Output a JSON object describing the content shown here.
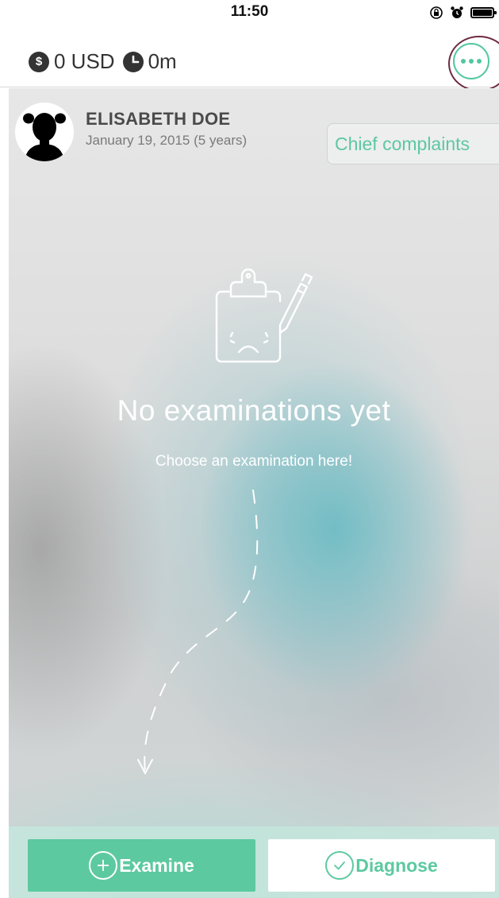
{
  "status_bar": {
    "time": "11:50"
  },
  "header": {
    "balance": "0 USD",
    "time_spent": "0m"
  },
  "patient": {
    "name": "ELISABETH DOE",
    "dob": "January 19, 2015 (5 years)",
    "chief_complaints_label": "Chief complaints"
  },
  "empty_state": {
    "title": "No examinations yet",
    "subtitle": "Choose an examination here!"
  },
  "actions": {
    "examine_label": "Examine",
    "diagnose_label": "Diagnose"
  },
  "colors": {
    "accent": "#5dc9a0",
    "annotation": "#6e2a42"
  }
}
